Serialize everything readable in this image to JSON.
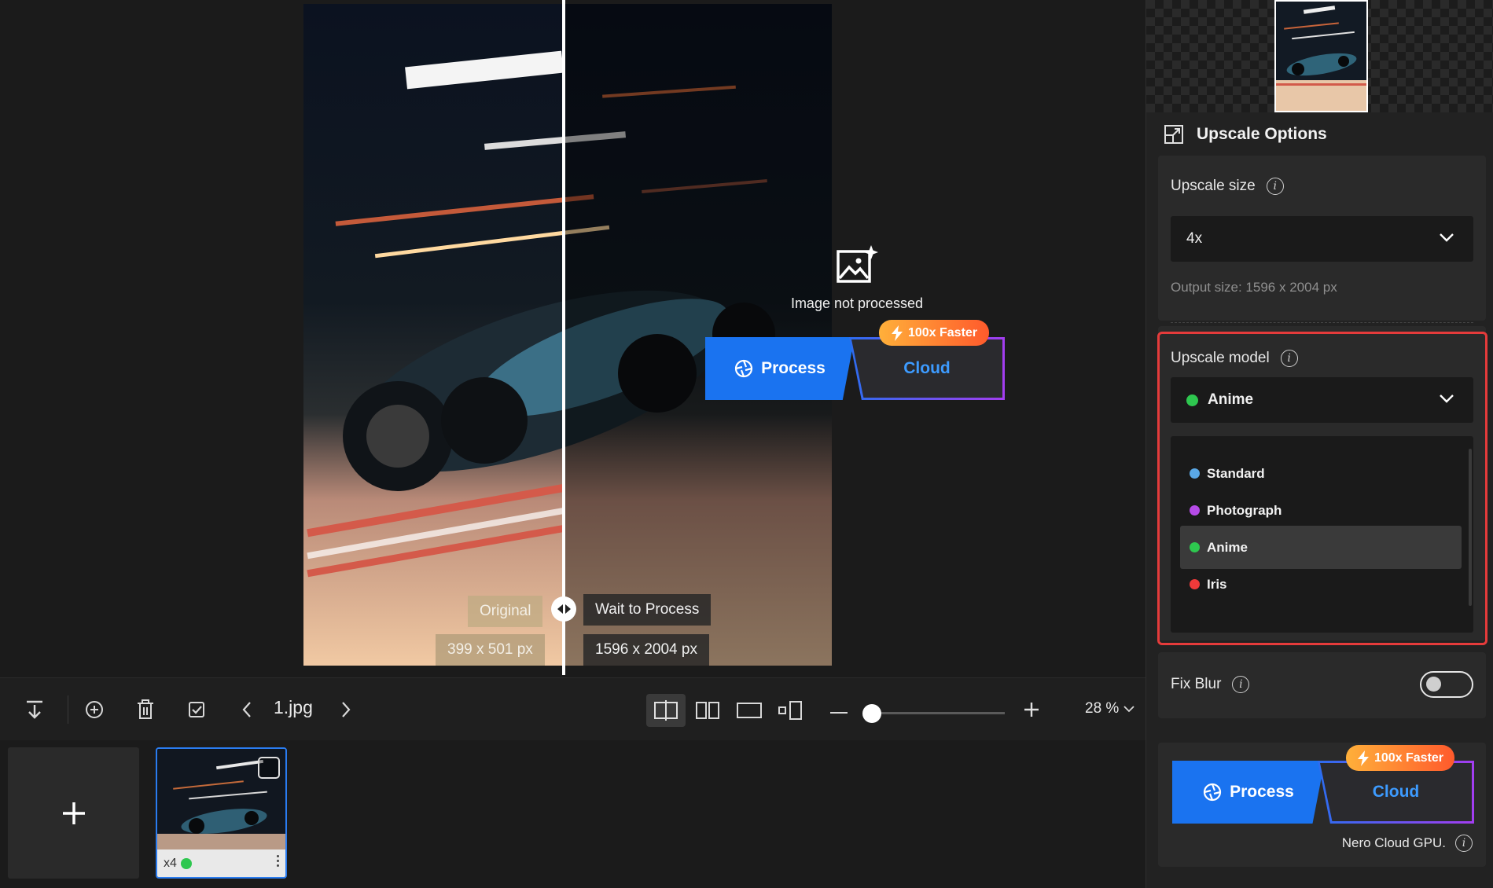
{
  "canvas": {
    "original_label": "Original",
    "original_size": "399 x 501 px",
    "wait_label": "Wait to Process",
    "processed_size": "1596 x 2004 px",
    "not_processed_text": "Image not processed",
    "process_label": "Process",
    "cloud_label": "Cloud",
    "faster_badge": "100x Faster"
  },
  "toolbar": {
    "file_name": "1.jpg",
    "zoom_value": "28 %",
    "zoom_level": 0.05,
    "icons": [
      "download-icon",
      "add-circle-icon",
      "trash-icon",
      "select-all-icon",
      "chevron-left-icon",
      "chevron-right-icon",
      "split-view-icon",
      "side-by-side-icon",
      "single-view-icon",
      "thumbnail-view-icon",
      "zoom-in-icon",
      "chevron-down-icon"
    ]
  },
  "thumbnail": {
    "scale": "x4",
    "status_color": "#2ec74f"
  },
  "panel": {
    "title": "Upscale Options",
    "upscale_size_label": "Upscale size",
    "upscale_size_value": "4x",
    "output_size": "Output size: 1596 x 2004 px",
    "upscale_model_label": "Upscale model",
    "model_selected": "Anime",
    "model_selected_color": "#2ec74f",
    "model_options": [
      {
        "name": "Standard",
        "color": "#5aa8e6"
      },
      {
        "name": "Photograph",
        "color": "#b64be8"
      },
      {
        "name": "Anime",
        "color": "#2ec74f"
      },
      {
        "name": "Iris",
        "color": "#ef3a3a"
      }
    ],
    "fix_blur_label": "Fix Blur",
    "fix_blur_on": false,
    "process_label": "Process",
    "cloud_label": "Cloud",
    "faster_badge": "100x Faster",
    "nero_gpu": "Nero Cloud GPU."
  },
  "colors": {
    "accent": "#1a73f0",
    "highlight": "#e53b3b",
    "badge": "#ff7a2c"
  }
}
